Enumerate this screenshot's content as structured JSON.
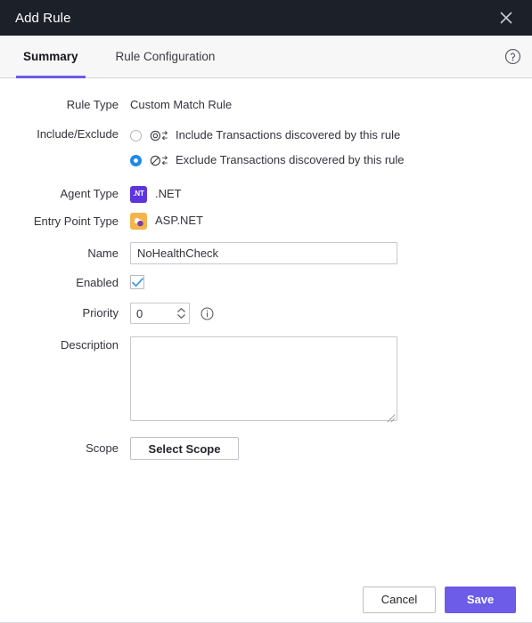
{
  "window": {
    "title": "Add Rule",
    "close_icon": "close-icon"
  },
  "tabs": {
    "items": [
      {
        "label": "Summary",
        "active": true
      },
      {
        "label": "Rule Configuration",
        "active": false
      }
    ],
    "help_icon": "help-circle-icon"
  },
  "form": {
    "rule_type": {
      "label": "Rule Type",
      "value": "Custom Match Rule"
    },
    "include_exclude": {
      "label": "Include/Exclude",
      "options": [
        {
          "label": "Include Transactions discovered by this rule",
          "selected": false,
          "icon": "include-transactions-icon"
        },
        {
          "label": "Exclude Transactions discovered by this rule",
          "selected": true,
          "icon": "exclude-transactions-icon"
        }
      ]
    },
    "agent_type": {
      "label": "Agent Type",
      "value": ".NET",
      "icon": "dotnet-icon",
      "icon_text": ".NT",
      "icon_color": "#5d34dd"
    },
    "entry_point_type": {
      "label": "Entry Point Type",
      "value": "ASP.NET",
      "icon": "aspnet-icon",
      "icon_color": "#f2b44c"
    },
    "name": {
      "label": "Name",
      "value": "NoHealthCheck",
      "placeholder": ""
    },
    "enabled": {
      "label": "Enabled",
      "checked": true,
      "check_color": "#3b93e0"
    },
    "priority": {
      "label": "Priority",
      "value": "0",
      "info_icon": "info-circle-icon"
    },
    "description": {
      "label": "Description",
      "value": "",
      "placeholder": ""
    },
    "scope": {
      "label": "Scope",
      "button_label": "Select Scope"
    }
  },
  "footer": {
    "cancel_label": "Cancel",
    "save_label": "Save",
    "save_color": "#6c5ce7"
  }
}
